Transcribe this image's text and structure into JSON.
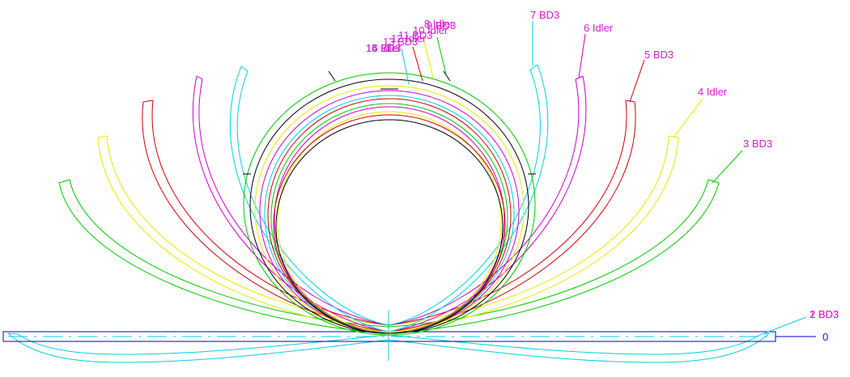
{
  "diagram": {
    "labels": {
      "zero": "0",
      "s1": "1 BD3",
      "s2": "2 BD3",
      "s3": "3 BD3",
      "s4": "4 Idler",
      "s5": "5 BD3",
      "s6": "6 Idler",
      "s7": "7 BD3",
      "s8": "8 Idler",
      "s9": "9 BD3",
      "s10": "10 Idler",
      "s11": "11 BD3",
      "s12": "12 Idler",
      "s13": "13 BD3",
      "s14": "14 Idler",
      "s15": "15 BD3",
      "s16": "16 Idler"
    },
    "colors": {
      "label": "#d21ecf",
      "zero_label": "#1a1acd",
      "baseline": "#0000cc",
      "cyan": "#00d0e0",
      "green": "#00c800",
      "yellow": "#e8e800",
      "red": "#cc0000",
      "magenta": "#cc00cc",
      "black": "#000000"
    }
  }
}
